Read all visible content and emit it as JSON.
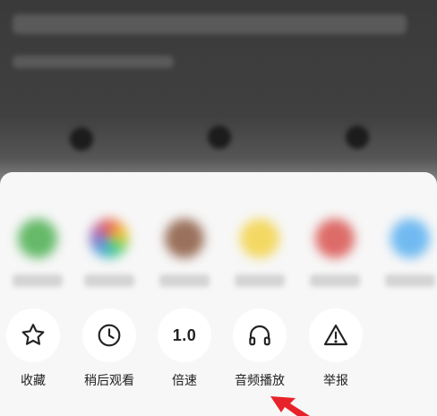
{
  "actions": [
    {
      "label": "收藏",
      "icon": "star-icon"
    },
    {
      "label": "稍后观看",
      "icon": "clock-icon"
    },
    {
      "label": "倍速",
      "icon": "speed-icon",
      "icon_text": "1.0"
    },
    {
      "label": "音频播放",
      "icon": "headphones-icon"
    },
    {
      "label": "举报",
      "icon": "warning-icon"
    }
  ],
  "share_targets": [
    {
      "icon": "wechat-icon",
      "color": "#4caf50"
    },
    {
      "icon": "moments-icon",
      "color": "#e8a040"
    },
    {
      "icon": "avatar-icon",
      "color": "#8a5a40"
    },
    {
      "icon": "yellow-app-icon",
      "color": "#f3d34a"
    },
    {
      "icon": "weibo-icon",
      "color": "#d9534f"
    },
    {
      "icon": "blue-app-icon",
      "color": "#5ab0f0"
    }
  ],
  "colors": {
    "sheet": "#f7f7f7",
    "circle": "#ffffff",
    "arrow": "#e8222a"
  }
}
